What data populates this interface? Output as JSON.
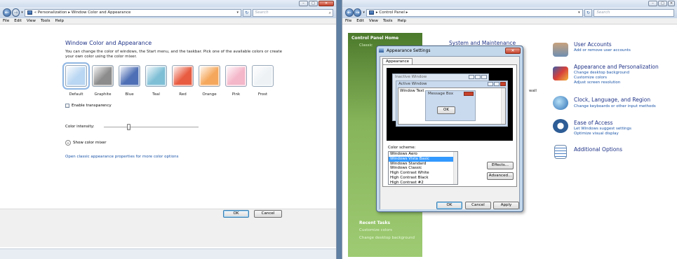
{
  "left_window": {
    "breadcrumb": "« Personalization ▸ Window Color and Appearance",
    "search_placeholder": "Search",
    "menu": [
      "File",
      "Edit",
      "View",
      "Tools",
      "Help"
    ],
    "heading": "Window Color and Appearance",
    "description": "You can change the color of windows, the Start menu, and the taskbar. Pick one of the available colors or create your own color using the color mixer.",
    "swatches": [
      {
        "label": "Default",
        "color": "#b9d6f2",
        "selected": true
      },
      {
        "label": "Graphite",
        "color": "#8c8c8c"
      },
      {
        "label": "Blue",
        "color": "#4e6fb5"
      },
      {
        "label": "Teal",
        "color": "#7fbfd6"
      },
      {
        "label": "Red",
        "color": "#e85c41"
      },
      {
        "label": "Orange",
        "color": "#f5a85c"
      },
      {
        "label": "Pink",
        "color": "#f4b6c9"
      },
      {
        "label": "Frost",
        "color": "#eef2f5"
      }
    ],
    "transparency_label": "Enable transparency",
    "intensity_label": "Color intensity:",
    "intensity_level": 0.25,
    "mixer_label": "Show color mixer",
    "classic_link": "Open classic appearance properties for more color options",
    "ok_label": "OK",
    "cancel_label": "Cancel"
  },
  "right_window": {
    "breadcrumb": "▸ Control Panel ▸",
    "search_placeholder": "Search",
    "menu": [
      "File",
      "Edit",
      "View",
      "Tools",
      "Help"
    ],
    "sidebar": {
      "home": "Control Panel Home",
      "classic": "Classic",
      "recent_title": "Recent Tasks",
      "recent": [
        "Customize colors",
        "Change desktop background"
      ]
    },
    "system_title": "System and Maintenance",
    "wall_fragment": "wall",
    "categories": [
      {
        "title": "User Accounts",
        "links": [
          "Add or remove user accounts"
        ]
      },
      {
        "title": "Appearance and Personalization",
        "links": [
          "Change desktop background",
          "Customize colors",
          "Adjust screen resolution"
        ]
      },
      {
        "title": "Clock, Language, and Region",
        "links": [
          "Change keyboards or other input methods"
        ]
      },
      {
        "title": "Ease of Access",
        "links": [
          "Let Windows suggest settings",
          "Optimize visual display"
        ]
      },
      {
        "title": "Additional Options",
        "links": []
      }
    ],
    "dialog": {
      "title": "Appearance Settings",
      "tab": "Appearance",
      "inactive_window": "Inactive Window",
      "active_window": "Active Window",
      "window_text": "Window Text",
      "message_box": "Message Box",
      "message_ok": "OK",
      "scheme_label": "Color scheme:",
      "schemes": [
        "Windows Aero",
        "Windows Vista Basic",
        "Windows Standard",
        "Windows Classic",
        "High Contrast White",
        "High Contrast Black",
        "High Contrast #2"
      ],
      "selected_scheme": "Windows Vista Basic",
      "effects_label": "Effects...",
      "advanced_label": "Advanced...",
      "ok_label": "OK",
      "cancel_label": "Cancel",
      "apply_label": "Apply"
    }
  }
}
